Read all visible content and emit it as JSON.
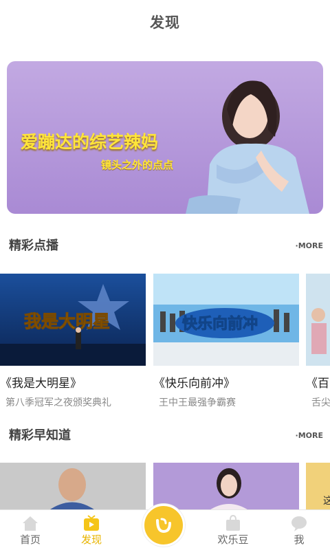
{
  "header": {
    "title": "发现"
  },
  "banner": {
    "headline": "爱蹦达的综艺辣妈",
    "subtitle": "镜头之外的点点"
  },
  "section_vod": {
    "title": "精彩点播",
    "more": "·MORE",
    "cards": [
      {
        "title": "《我是大明星》",
        "desc": "第八季冠军之夜颁奖典礼",
        "thumb_text": "我是大明星"
      },
      {
        "title": "《快乐向前冲》",
        "desc": "王中王最强争霸赛",
        "thumb_text": "快乐向前冲"
      },
      {
        "title": "《百",
        "desc": "舌尖"
      }
    ]
  },
  "section_early": {
    "title": "精彩早知道",
    "more": "·MORE",
    "partial_text": "这"
  },
  "tabbar": {
    "items": [
      {
        "label": "首页",
        "icon": "home-icon"
      },
      {
        "label": "发现",
        "icon": "tv-icon"
      },
      {
        "label": "",
        "icon": "app-logo-icon"
      },
      {
        "label": "欢乐豆",
        "icon": "bag-icon"
      },
      {
        "label": "我",
        "icon": "chat-bubble-icon"
      }
    ],
    "active_index": 1
  },
  "colors": {
    "accent": "#f7c52b",
    "banner_bg": "#b29ae0",
    "headline_yellow": "#ffe53a",
    "tab_active": "#e8b400"
  }
}
